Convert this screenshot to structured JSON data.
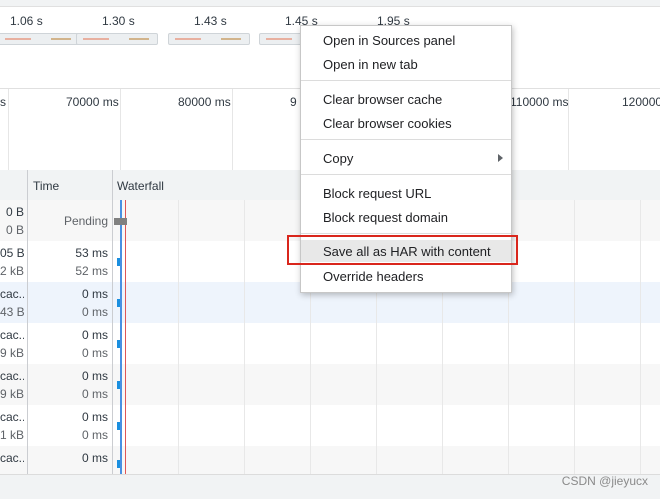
{
  "filmstrip": {
    "frames": [
      "1.06 s",
      "1.30 s",
      "1.43 s",
      "1.45 s",
      "1.95 s"
    ]
  },
  "overview": {
    "labels": [
      "s",
      "70000 ms",
      "80000 ms",
      "9",
      "110000 ms",
      "120000"
    ]
  },
  "table": {
    "headers": {
      "time": "Time",
      "waterfall": "Waterfall"
    },
    "rows": [
      {
        "size": "0 B",
        "size2": "0 B",
        "time_main": "Pending",
        "time2": ""
      },
      {
        "size": "05 B",
        "size2": "2 kB",
        "time_main": "53 ms",
        "time2": "52 ms"
      },
      {
        "size": "cac...",
        "size2": "43 B",
        "time_main": "0 ms",
        "time2": "0 ms"
      },
      {
        "size": "cac...",
        "size2": "9 kB",
        "time_main": "0 ms",
        "time2": "0 ms"
      },
      {
        "size": "cac...",
        "size2": "9 kB",
        "time_main": "0 ms",
        "time2": "0 ms"
      },
      {
        "size": "cac...",
        "size2": "1 kB",
        "time_main": "0 ms",
        "time2": "0 ms"
      },
      {
        "size": "cac...",
        "size2": "",
        "time_main": "0 ms",
        "time2": ""
      }
    ]
  },
  "context_menu": {
    "items": [
      "Open in Sources panel",
      "Open in new tab",
      "Clear browser cache",
      "Clear browser cookies",
      "Copy",
      "Block request URL",
      "Block request domain",
      "Save all as HAR with content",
      "Override headers"
    ],
    "highlighted": "Save all as HAR with content"
  },
  "watermark": "CSDN @jieyucx",
  "colors": {
    "highlight_border": "#d9261c",
    "waterfall_bar": "#1a8fe0"
  }
}
